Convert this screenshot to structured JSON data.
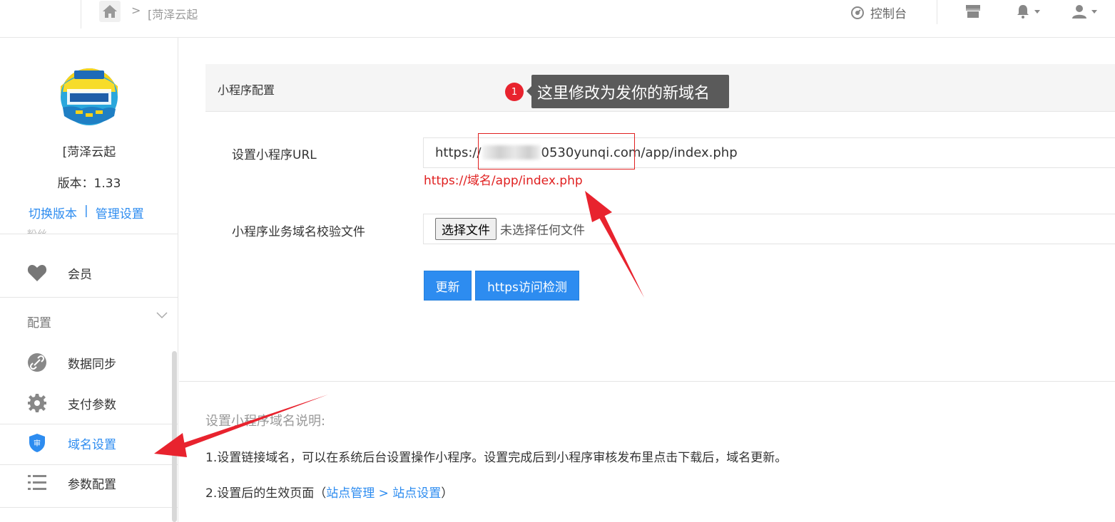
{
  "header": {
    "breadcrumb_separator": ">",
    "breadcrumb_name": "[菏泽云起",
    "console_label": "控制台"
  },
  "sidebar": {
    "account_name": "[菏泽云起",
    "version_label": "版本：1.33",
    "switch_version": "切换版本",
    "link_separator": "|",
    "manage_settings": "管理设置",
    "faded_label": "粉丝",
    "member_label": "会员",
    "section_config": "配置",
    "items": [
      {
        "label": "数据同步",
        "icon": "link-icon"
      },
      {
        "label": "支付参数",
        "icon": "gear-icon"
      },
      {
        "label": "域名设置",
        "icon": "shield-icon",
        "active": true
      },
      {
        "label": "参数配置",
        "icon": "list-icon"
      }
    ]
  },
  "panel": {
    "title": "小程序配置",
    "annotation_badge": "1",
    "annotation_text": "这里修改为发你的新域名",
    "url_label": "设置小程序URL",
    "url_prefix": "https://",
    "url_suffix": "0530yunqi.com/app/index.php",
    "url_hint": "https://域名/app/index.php",
    "file_label": "小程序业务域名校验文件",
    "file_button": "选择文件",
    "file_status": "未选择任何文件",
    "update_button": "更新",
    "check_button": "https访问检测"
  },
  "notes": {
    "title": "设置小程序域名说明:",
    "line1": "1.设置链接域名，可以在系统后台设置操作小程序。设置完成后到小程序审核发布里点击下载后，域名更新。",
    "line2_prefix": "2.设置后的生效页面（",
    "line2_link1": "站点管理",
    "line2_arrow": " > ",
    "line2_link2": "站点设置",
    "line2_suffix": "）"
  },
  "colors": {
    "accent": "#2d8cf0",
    "annotation_red": "#e02020",
    "tooltip_bg": "#5a5a5a"
  }
}
